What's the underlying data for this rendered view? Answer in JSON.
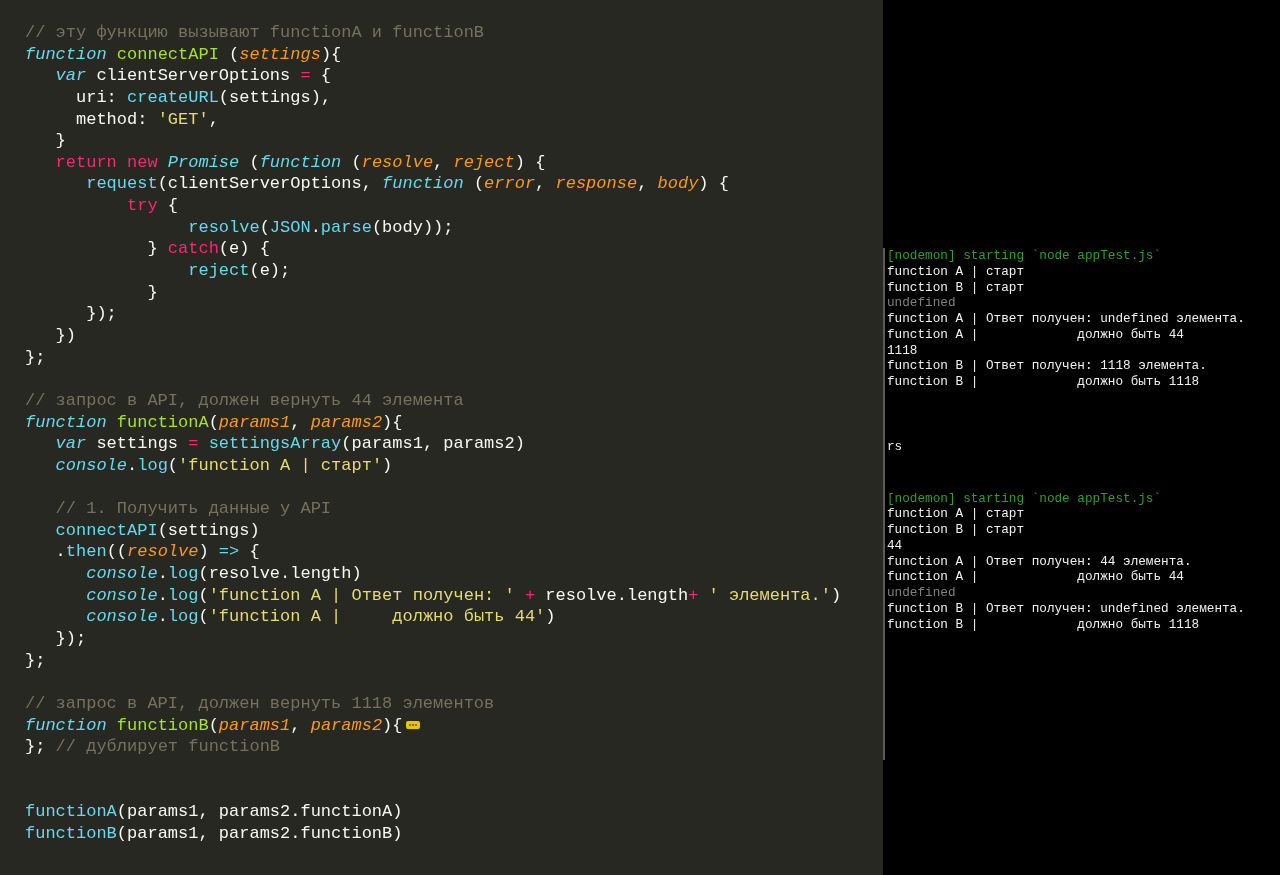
{
  "editor": {
    "lines": [
      {
        "kind": "code",
        "tokens": [
          {
            "kind": "comment",
            "text": "// эту функцию вызывают functionA и functionB"
          }
        ]
      },
      {
        "kind": "code",
        "tokens": [
          {
            "kind": "storage",
            "text": "function "
          },
          {
            "kind": "entity",
            "text": "connectAPI"
          },
          {
            "kind": "plain",
            "text": " ("
          },
          {
            "kind": "param",
            "text": "settings"
          },
          {
            "kind": "plain",
            "text": "){"
          }
        ]
      },
      {
        "kind": "code",
        "tokens": [
          {
            "kind": "storage",
            "text": "   var"
          },
          {
            "kind": "plain",
            "text": " clientServerOptions "
          },
          {
            "kind": "keyword",
            "text": "="
          },
          {
            "kind": "plain",
            "text": " {"
          }
        ]
      },
      {
        "kind": "code",
        "tokens": [
          {
            "kind": "plain",
            "text": "     uri: "
          },
          {
            "kind": "support",
            "text": "createURL"
          },
          {
            "kind": "plain",
            "text": "(settings),"
          }
        ]
      },
      {
        "kind": "code",
        "tokens": [
          {
            "kind": "plain",
            "text": "     method: "
          },
          {
            "kind": "string",
            "text": "'GET'"
          },
          {
            "kind": "plain",
            "text": ","
          }
        ]
      },
      {
        "kind": "code",
        "tokens": [
          {
            "kind": "plain",
            "text": "   }"
          }
        ]
      },
      {
        "kind": "code",
        "tokens": [
          {
            "kind": "keyword",
            "text": "   return new "
          },
          {
            "kind": "storage",
            "text": "Promise"
          },
          {
            "kind": "plain",
            "text": " ("
          },
          {
            "kind": "storage",
            "text": "function"
          },
          {
            "kind": "plain",
            "text": " ("
          },
          {
            "kind": "param",
            "text": "resolve"
          },
          {
            "kind": "plain",
            "text": ", "
          },
          {
            "kind": "param",
            "text": "reject"
          },
          {
            "kind": "plain",
            "text": ") {"
          }
        ]
      },
      {
        "kind": "code",
        "tokens": [
          {
            "kind": "support",
            "text": "      request"
          },
          {
            "kind": "plain",
            "text": "(clientServerOptions, "
          },
          {
            "kind": "storage",
            "text": "function"
          },
          {
            "kind": "plain",
            "text": " ("
          },
          {
            "kind": "param",
            "text": "error"
          },
          {
            "kind": "plain",
            "text": ", "
          },
          {
            "kind": "param",
            "text": "response"
          },
          {
            "kind": "plain",
            "text": ", "
          },
          {
            "kind": "param",
            "text": "body"
          },
          {
            "kind": "plain",
            "text": ") {"
          }
        ]
      },
      {
        "kind": "code",
        "tokens": [
          {
            "kind": "keyword",
            "text": "          try"
          },
          {
            "kind": "plain",
            "text": " {"
          }
        ]
      },
      {
        "kind": "code",
        "tokens": [
          {
            "kind": "support",
            "text": "                resolve"
          },
          {
            "kind": "plain",
            "text": "("
          },
          {
            "kind": "support",
            "text": "JSON"
          },
          {
            "kind": "plain",
            "text": "."
          },
          {
            "kind": "support",
            "text": "parse"
          },
          {
            "kind": "plain",
            "text": "(body));"
          }
        ]
      },
      {
        "kind": "code",
        "tokens": [
          {
            "kind": "plain",
            "text": "            } "
          },
          {
            "kind": "keyword",
            "text": "catch"
          },
          {
            "kind": "plain",
            "text": "(e) {"
          }
        ]
      },
      {
        "kind": "code",
        "tokens": [
          {
            "kind": "support",
            "text": "                reject"
          },
          {
            "kind": "plain",
            "text": "(e);"
          }
        ]
      },
      {
        "kind": "code",
        "tokens": [
          {
            "kind": "plain",
            "text": "            }"
          }
        ]
      },
      {
        "kind": "code",
        "tokens": [
          {
            "kind": "plain",
            "text": "      });"
          }
        ]
      },
      {
        "kind": "code",
        "tokens": [
          {
            "kind": "plain",
            "text": "   })"
          }
        ]
      },
      {
        "kind": "code",
        "tokens": [
          {
            "kind": "plain",
            "text": "};"
          }
        ]
      },
      {
        "kind": "blank"
      },
      {
        "kind": "code",
        "tokens": [
          {
            "kind": "comment",
            "text": "// запрос в API, должен вернуть 44 элемента"
          }
        ]
      },
      {
        "kind": "code",
        "tokens": [
          {
            "kind": "storage",
            "text": "function "
          },
          {
            "kind": "entity",
            "text": "functionA"
          },
          {
            "kind": "plain",
            "text": "("
          },
          {
            "kind": "param",
            "text": "params1"
          },
          {
            "kind": "plain",
            "text": ", "
          },
          {
            "kind": "param",
            "text": "params2"
          },
          {
            "kind": "plain",
            "text": "){"
          }
        ]
      },
      {
        "kind": "code",
        "tokens": [
          {
            "kind": "storage",
            "text": "   var"
          },
          {
            "kind": "plain",
            "text": " settings "
          },
          {
            "kind": "keyword",
            "text": "="
          },
          {
            "kind": "support",
            "text": " settingsArray"
          },
          {
            "kind": "plain",
            "text": "(params1, params2)"
          }
        ]
      },
      {
        "kind": "code",
        "tokens": [
          {
            "kind": "storage",
            "text": "   console"
          },
          {
            "kind": "plain",
            "text": "."
          },
          {
            "kind": "support",
            "text": "log"
          },
          {
            "kind": "plain",
            "text": "("
          },
          {
            "kind": "string",
            "text": "'function A | старт'"
          },
          {
            "kind": "plain",
            "text": ")"
          }
        ]
      },
      {
        "kind": "blank"
      },
      {
        "kind": "code",
        "tokens": [
          {
            "kind": "comment",
            "text": "   // 1. Получить данные у API"
          }
        ]
      },
      {
        "kind": "code",
        "tokens": [
          {
            "kind": "support",
            "text": "   connectAPI"
          },
          {
            "kind": "plain",
            "text": "(settings)"
          }
        ]
      },
      {
        "kind": "code",
        "tokens": [
          {
            "kind": "plain",
            "text": "   ."
          },
          {
            "kind": "support",
            "text": "then"
          },
          {
            "kind": "plain",
            "text": "(("
          },
          {
            "kind": "param",
            "text": "resolve"
          },
          {
            "kind": "plain",
            "text": ") "
          },
          {
            "kind": "support",
            "text": "=>"
          },
          {
            "kind": "plain",
            "text": " {"
          }
        ]
      },
      {
        "kind": "code",
        "tokens": [
          {
            "kind": "storage",
            "text": "      console"
          },
          {
            "kind": "plain",
            "text": "."
          },
          {
            "kind": "support",
            "text": "log"
          },
          {
            "kind": "plain",
            "text": "(resolve.length)"
          }
        ]
      },
      {
        "kind": "code",
        "tokens": [
          {
            "kind": "storage",
            "text": "      console"
          },
          {
            "kind": "plain",
            "text": "."
          },
          {
            "kind": "support",
            "text": "log"
          },
          {
            "kind": "plain",
            "text": "("
          },
          {
            "kind": "string",
            "text": "'function A | Ответ получен: '"
          },
          {
            "kind": "keyword",
            "text": " +"
          },
          {
            "kind": "plain",
            "text": " resolve.length"
          },
          {
            "kind": "keyword",
            "text": "+"
          },
          {
            "kind": "string",
            "text": " ' элемента.'"
          },
          {
            "kind": "plain",
            "text": ")"
          }
        ]
      },
      {
        "kind": "code",
        "tokens": [
          {
            "kind": "storage",
            "text": "      console"
          },
          {
            "kind": "plain",
            "text": "."
          },
          {
            "kind": "support",
            "text": "log"
          },
          {
            "kind": "plain",
            "text": "("
          },
          {
            "kind": "string",
            "text": "'function A |     должно быть 44'"
          },
          {
            "kind": "plain",
            "text": ")"
          }
        ]
      },
      {
        "kind": "code",
        "tokens": [
          {
            "kind": "plain",
            "text": "   });"
          }
        ]
      },
      {
        "kind": "code",
        "tokens": [
          {
            "kind": "plain",
            "text": "};"
          }
        ]
      },
      {
        "kind": "blank"
      },
      {
        "kind": "code",
        "tokens": [
          {
            "kind": "comment",
            "text": "// запрос в API, должен вернуть 1118 элементов"
          }
        ]
      },
      {
        "kind": "code",
        "folded": true,
        "tokens": [
          {
            "kind": "storage",
            "text": "function "
          },
          {
            "kind": "entity",
            "text": "functionB"
          },
          {
            "kind": "plain",
            "text": "("
          },
          {
            "kind": "param",
            "text": "params1"
          },
          {
            "kind": "plain",
            "text": ", "
          },
          {
            "kind": "param",
            "text": "params2"
          },
          {
            "kind": "plain",
            "text": "){"
          }
        ]
      },
      {
        "kind": "code",
        "tokens": [
          {
            "kind": "plain",
            "text": "}; "
          },
          {
            "kind": "comment",
            "text": "// дублирует functionB"
          }
        ]
      },
      {
        "kind": "blank"
      },
      {
        "kind": "blank"
      },
      {
        "kind": "code",
        "tokens": [
          {
            "kind": "support",
            "text": "functionA"
          },
          {
            "kind": "plain",
            "text": "(params1, params2.functionA)"
          }
        ]
      },
      {
        "kind": "code",
        "tokens": [
          {
            "kind": "support",
            "text": "functionB"
          },
          {
            "kind": "plain",
            "text": "(params1, params2.functionB)"
          }
        ]
      }
    ]
  },
  "terminal": {
    "blocks": [
      {
        "lines": [
          {
            "kind": "notice",
            "text": "[nodemon] starting `node appTest.js`"
          },
          {
            "kind": "output",
            "text": "function A | старт"
          },
          {
            "kind": "output",
            "text": "function B | старт"
          },
          {
            "kind": "muted",
            "text": "undefined"
          },
          {
            "kind": "output",
            "text": "function A | Ответ получен: undefined элемента."
          },
          {
            "kind": "output",
            "text": "function A |             должно быть 44"
          },
          {
            "kind": "output",
            "text": "1118"
          },
          {
            "kind": "output",
            "text": "function B | Ответ получен: 1118 элемента."
          },
          {
            "kind": "output",
            "text": "function B |             должно быть 1118"
          }
        ]
      },
      {
        "lines": [
          {
            "kind": "output",
            "text": "rs"
          }
        ]
      },
      {
        "lines": [
          {
            "kind": "notice",
            "text": "[nodemon] starting `node appTest.js`"
          },
          {
            "kind": "output",
            "text": "function A | старт"
          },
          {
            "kind": "output",
            "text": "function B | старт"
          },
          {
            "kind": "output",
            "text": "44"
          },
          {
            "kind": "output",
            "text": "function A | Ответ получен: 44 элемента."
          },
          {
            "kind": "output",
            "text": "function A |             должно быть 44"
          },
          {
            "kind": "muted",
            "text": "undefined"
          },
          {
            "kind": "output",
            "text": "function B | Ответ получен: undefined элемента."
          },
          {
            "kind": "output",
            "text": "function B |             должно быть 1118"
          }
        ]
      }
    ]
  }
}
